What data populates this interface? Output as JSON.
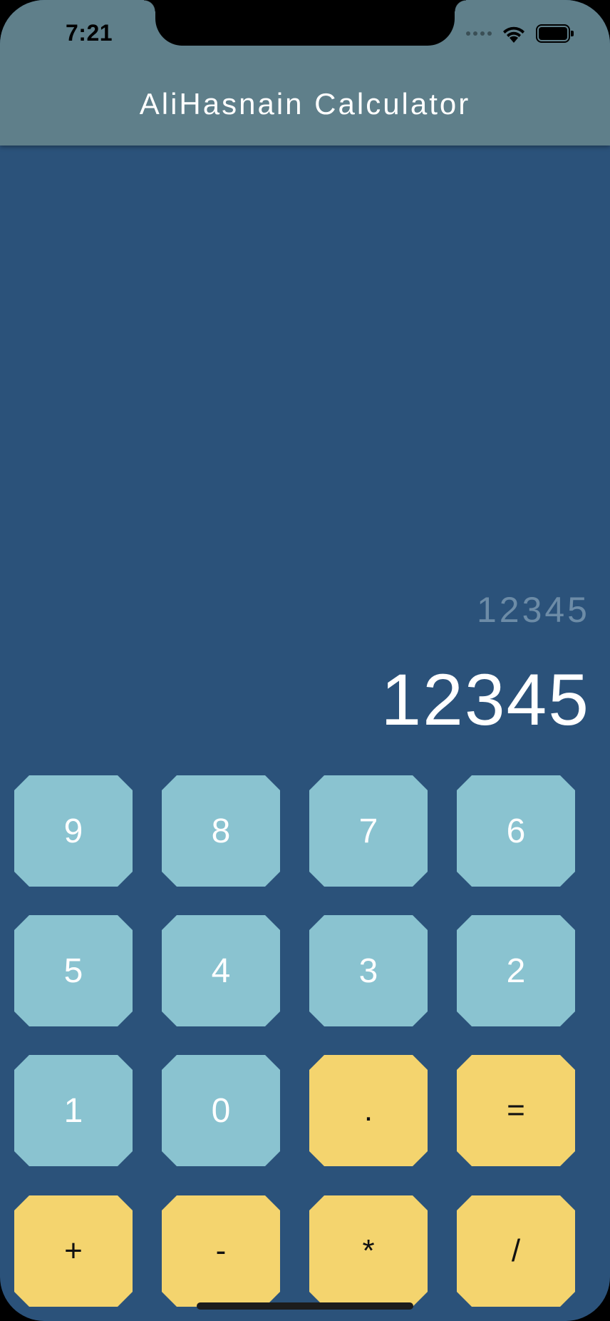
{
  "status_bar": {
    "time": "7:21"
  },
  "app_bar": {
    "title": "AliHasnain Calculator"
  },
  "display": {
    "expression": "12345",
    "result": "12345"
  },
  "keys": {
    "k9": "9",
    "k8": "8",
    "k7": "7",
    "k6": "6",
    "k5": "5",
    "k4": "4",
    "k3": "3",
    "k2": "2",
    "k1": "1",
    "k0": "0",
    "dot": ".",
    "equals": "=",
    "plus": "+",
    "minus": "-",
    "multiply": "*",
    "divide": "/"
  },
  "colors": {
    "background": "#2b527a",
    "app_bar": "#5f7f8a",
    "number_key": "#8ac3d0",
    "operator_key": "#f4d46e",
    "expression_text": "#6d8ca7"
  },
  "icons": [
    "signal-dots-icon",
    "wifi-icon",
    "battery-icon"
  ]
}
